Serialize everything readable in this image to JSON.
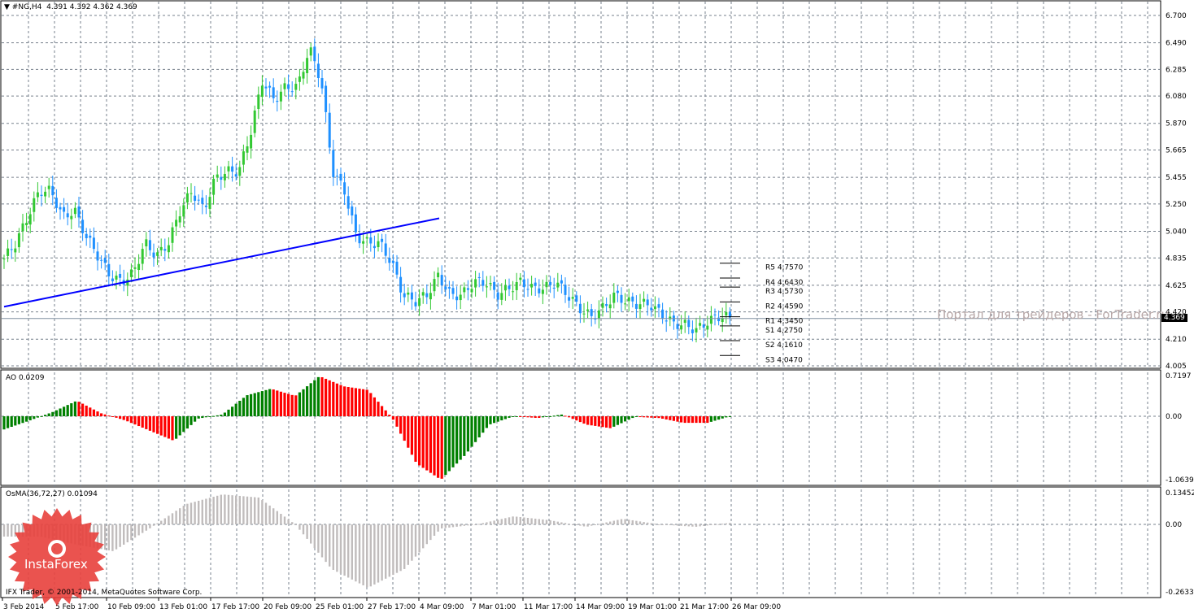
{
  "header": {
    "symbol": "#NG,H4",
    "ohlc": "4.391 4.392 4.362 4.369"
  },
  "watermark": "Портал для трейдеров - ForTrader.ru",
  "copyright": "IFX Trader, © 2001-2014, MetaQuotes Software Corp.",
  "logo": "InstaForex",
  "colors": {
    "bull": "#32c832",
    "bear": "#1e90ff",
    "ao_up": "#008000",
    "ao_down": "#ff0000",
    "osma": "#c0bcbc",
    "trend": "#0000ff",
    "grid": "#77808c"
  },
  "current_price": "4.369",
  "pivots": [
    {
      "label": "R5 4,7570",
      "v": 4.757
    },
    {
      "label": "R4 4,6430",
      "v": 4.643
    },
    {
      "label": "R3 4,5730",
      "v": 4.573
    },
    {
      "label": "R2 4,4590",
      "v": 4.459
    },
    {
      "label": "R1 4,3450",
      "v": 4.345
    },
    {
      "label": "S1 4,2750",
      "v": 4.275
    },
    {
      "label": "S2 4,1610",
      "v": 4.161
    },
    {
      "label": "S3 4,0470",
      "v": 4.047
    }
  ],
  "ao": {
    "title": "AO 0.0209",
    "ticks": [
      "0.7197",
      "0.00",
      "-1.0639"
    ]
  },
  "osma": {
    "title": "OsMA(36,72,27) 0.01094",
    "ticks": [
      "0.13452",
      "0.00",
      "-0.2633"
    ]
  },
  "chart_data": {
    "type": "candlestick",
    "price_ticks": [
      "6.700",
      "6.490",
      "6.285",
      "6.080",
      "5.870",
      "5.665",
      "5.455",
      "5.250",
      "5.040",
      "4.835",
      "4.625",
      "4.420",
      "4.210",
      "4.005"
    ],
    "time_ticks": [
      "3 Feb 2014",
      "5 Feb 17:00",
      "10 Feb 09:00",
      "13 Feb 01:00",
      "17 Feb 17:00",
      "20 Feb 09:00",
      "25 Feb 01:00",
      "27 Feb 17:00",
      "4 Mar 09:00",
      "7 Mar 01:00",
      "11 Mar 17:00",
      "14 Mar 09:00",
      "19 Mar 01:00",
      "21 Mar 17:00",
      "26 Mar 09:00"
    ],
    "ylim": [
      4.005,
      6.7
    ],
    "price_close": [
      4.83,
      4.95,
      5.15,
      5.35,
      5.35,
      5.15,
      5.2,
      5.0,
      4.85,
      4.7,
      4.65,
      4.72,
      4.95,
      4.85,
      4.95,
      5.2,
      5.35,
      5.2,
      5.45,
      5.5,
      5.5,
      5.8,
      6.2,
      6.05,
      6.15,
      6.15,
      6.45,
      6.2,
      5.5,
      5.35,
      5.0,
      4.95,
      4.95,
      4.8,
      4.55,
      4.5,
      4.55,
      4.7,
      4.55,
      4.55,
      4.65,
      4.65,
      4.55,
      4.6,
      4.65,
      4.6,
      4.6,
      4.65,
      4.55,
      4.45,
      4.38,
      4.45,
      4.55,
      4.5,
      4.48,
      4.48,
      4.4,
      4.33,
      4.32,
      4.28,
      4.35,
      4.39,
      4.37
    ],
    "trendline": [
      4.46,
      5.14
    ],
    "ao_values": [
      -0.22,
      -0.08,
      0.07,
      0.26,
      0.05,
      -0.07,
      -0.24,
      -0.41,
      -0.04,
      0.03,
      0.35,
      0.46,
      0.34,
      0.67,
      0.5,
      0.44,
      -0.03,
      -0.79,
      -1.06,
      -0.65,
      -0.14,
      0.0,
      -0.03,
      0.03,
      -0.14,
      -0.2,
      -0.01,
      -0.03,
      -0.11,
      -0.11,
      0.01
    ],
    "osma_values": [
      -0.05,
      -0.05,
      -0.083,
      -0.11,
      -0.017,
      0.083,
      0.123,
      0.11,
      0.0,
      -0.183,
      -0.26,
      -0.183,
      -0.017,
      0.0,
      0.033,
      0.017,
      -0.01,
      0.023,
      0.0,
      -0.01,
      0.007
    ]
  }
}
